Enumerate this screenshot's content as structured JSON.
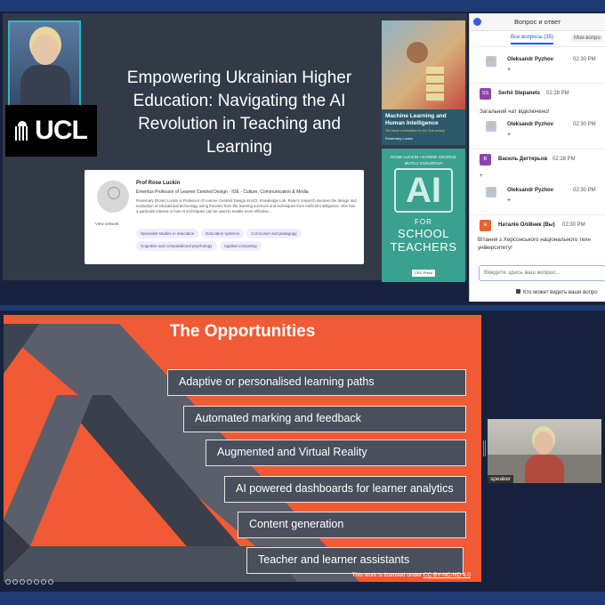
{
  "slide1": {
    "title": "Empowering Ukrainian Higher Education: Navigating the AI Revolution in Teaching and Learning",
    "logo_text": "UCL",
    "profile": {
      "name": "Prof Rose Luckin",
      "role": "Emeritus Professor of Learner Centred Design · IOE - Culture, Communication & Media",
      "bio": "Rosemary (Rose) Luckin is Professor of Learner Centred Design at UCL Knowledge Lab. Rose's research involves the design and evaluation of educational technology using theories from the learning sciences and techniques from Artificial Intelligence. She has a particular interest in how AI techniques can be used to enable more effective...",
      "view_network": "View network",
      "tags": [
        "Specialist studies in education",
        "Education systems",
        "Curriculum and pedagogy",
        "Cognitive and computational psychology",
        "Applied computing"
      ]
    },
    "book1": {
      "title": "Machine Learning and Human Intelligence",
      "subtitle": "The future of education for the 21st century",
      "author": "Rosemary Luckin"
    },
    "book2": {
      "authors": "ROSE LUCKIN • KARINE GEORGE MUTLU CUKUROVA",
      "ai": "AI",
      "for": "FOR",
      "title": "SCHOOL TEACHERS",
      "publisher": "CRC Press"
    }
  },
  "qa": {
    "title": "Вопрос и ответ",
    "tab_all": "Все вопросы (35)",
    "tab_mine": "Мои вопро",
    "messages": [
      {
        "type": "reply",
        "name": "Oleksandr Pyzhov",
        "time": "02:30 PM",
        "plus": "+"
      },
      {
        "type": "msg",
        "initials": "SS",
        "name": "Serhii Stepanets",
        "time": "02:28 PM",
        "text": "Загальний чат відключено!",
        "color": "#8e44ad"
      },
      {
        "type": "reply",
        "name": "Oleksandr Pyzhov",
        "time": "02:30 PM",
        "plus": "+"
      },
      {
        "type": "msg",
        "initials": "В",
        "name": "Василь Дегтярьов",
        "time": "02:28 PM",
        "text": "+",
        "color": "#8e44ad"
      },
      {
        "type": "reply",
        "name": "Oleksandr Pyzhov",
        "time": "02:30 PM",
        "plus": "+"
      },
      {
        "type": "msg",
        "initials": "Н",
        "name": "Наталія Олійник (Вы)",
        "time": "02:30 PM",
        "text": "Вітання з Херсонського національного техн університету!",
        "color": "#e8642c"
      }
    ],
    "input_placeholder": "Введите здесь ваш вопрос...",
    "who_sees": "Кто может видеть ваши вопро"
  },
  "slide2": {
    "title": "The Opportunities",
    "items": [
      "Adaptive or personalised learning paths",
      "Automated marking and feedback",
      "Augmented and Virtual Reality",
      "AI powered dashboards for learner analytics",
      "Content generation",
      "Teacher and learner assistants"
    ],
    "license_prefix": "This work is licensed under ",
    "license_link": "CC BY-NC-ND 4.0"
  },
  "video": {
    "label": "speaker"
  },
  "colors": {
    "slide2_bg": "#f05a34",
    "item_bg": "#4a4f5c",
    "qa_accent": "#1a5fd6"
  }
}
